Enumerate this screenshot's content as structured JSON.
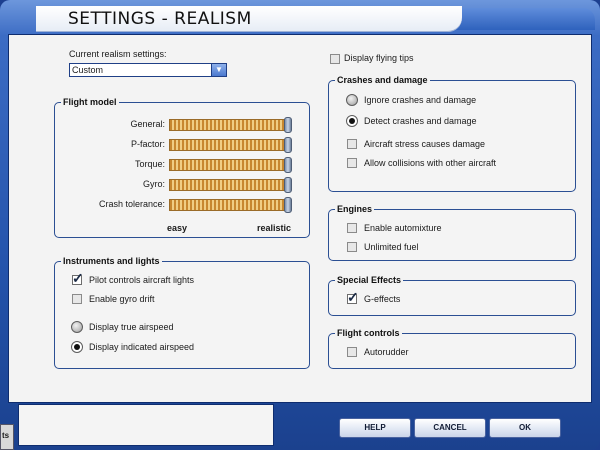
{
  "window": {
    "title": "SETTINGS - REALISM"
  },
  "realism": {
    "label": "Current realism settings:",
    "value": "Custom"
  },
  "display_tips": {
    "label": "Display flying tips",
    "checked": false
  },
  "flight_model": {
    "title": "Flight model",
    "sliders": [
      {
        "label": "General:",
        "level": 1.0
      },
      {
        "label": "P-factor:",
        "level": 1.0
      },
      {
        "label": "Torque:",
        "level": 1.0
      },
      {
        "label": "Gyro:",
        "level": 1.0
      },
      {
        "label": "Crash tolerance:",
        "level": 1.0
      }
    ],
    "easy_label": "easy",
    "realistic_label": "realistic"
  },
  "instruments": {
    "title": "Instruments and lights",
    "pilot_lights": {
      "label": "Pilot controls aircraft lights",
      "checked": true
    },
    "gyro_drift": {
      "label": "Enable gyro drift",
      "checked": false
    },
    "true_airspeed": {
      "label": "Display true airspeed",
      "selected": false
    },
    "indicated_airspeed": {
      "label": "Display indicated airspeed",
      "selected": true
    }
  },
  "crashes": {
    "title": "Crashes and damage",
    "ignore": {
      "label": "Ignore crashes and damage",
      "selected": false
    },
    "detect": {
      "label": "Detect crashes and damage",
      "selected": true
    },
    "stress": {
      "label": "Aircraft stress causes damage",
      "checked": false
    },
    "collisions": {
      "label": "Allow collisions with other aircraft",
      "checked": false
    }
  },
  "engines": {
    "title": "Engines",
    "automixture": {
      "label": "Enable automixture",
      "checked": false
    },
    "unlimited_fuel": {
      "label": "Unlimited fuel",
      "checked": false
    }
  },
  "special_effects": {
    "title": "Special Effects",
    "g_effects": {
      "label": "G-effects",
      "checked": true
    }
  },
  "flight_controls": {
    "title": "Flight controls",
    "autorudder": {
      "label": "Autorudder",
      "checked": false
    }
  },
  "buttons": {
    "help": "HELP",
    "cancel": "CANCEL",
    "ok": "OK"
  },
  "edge_tab": "ts",
  "colors": {
    "chrome": "#2453ab",
    "slider": "#c7872f",
    "panel": "#f3f3f3"
  }
}
